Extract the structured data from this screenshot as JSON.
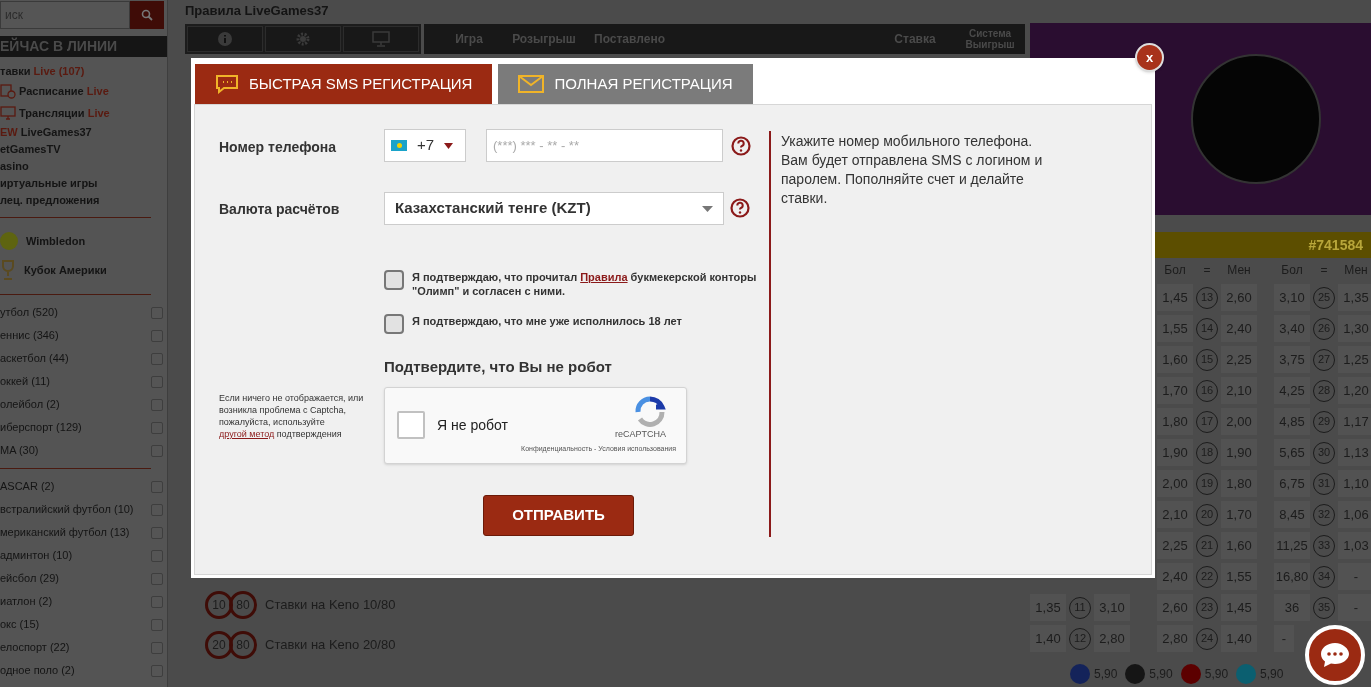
{
  "sidebar": {
    "search": {
      "placeholder": "иск"
    },
    "heading": "ЕЙЧАС В ЛИНИИ",
    "nav": [
      {
        "kind": "plain",
        "label": "тавки",
        "accent": "Live (107)"
      },
      {
        "kind": "schedule",
        "label": "Расписание",
        "accent": "Live"
      },
      {
        "kind": "broadcast",
        "label": "Трансляции",
        "accent": "Live"
      },
      {
        "kind": "plain",
        "badge": "EW",
        "label": "LiveGames37"
      },
      {
        "kind": "plain",
        "label": "etGamesTV"
      },
      {
        "kind": "plain",
        "label": "asino"
      },
      {
        "kind": "plain",
        "label": "иртуальные игры"
      },
      {
        "kind": "plain",
        "label": "лец. предложения"
      }
    ],
    "featured": [
      {
        "kind": "ball",
        "label": "Wimbledon"
      },
      {
        "kind": "cup",
        "label": "Кубок Америки"
      }
    ],
    "sport_groups": [
      [
        {
          "label": "утбол (520)",
          "checked": false
        },
        {
          "label": "еннис (346)",
          "checked": false
        },
        {
          "label": "аскетбол (44)",
          "checked": false
        },
        {
          "label": "оккей (11)",
          "checked": false
        },
        {
          "label": "олейбол (2)",
          "checked": false
        },
        {
          "label": "иберспорт (129)",
          "checked": false
        },
        {
          "label": "MA (30)",
          "checked": false
        }
      ],
      [
        {
          "label": "ASCAR (2)",
          "checked": false
        },
        {
          "label": "встралийский футбол (10)",
          "checked": false
        },
        {
          "label": "мериканский футбол (13)",
          "checked": false
        },
        {
          "label": "админтон (10)",
          "checked": false
        },
        {
          "label": "ейсбол (29)",
          "checked": false
        },
        {
          "label": "иатлон (2)",
          "checked": false
        },
        {
          "label": "окс (15)",
          "checked": false
        },
        {
          "label": "елоспорт (22)",
          "checked": false
        },
        {
          "label": "одное поло (2)",
          "checked": false
        }
      ]
    ]
  },
  "main": {
    "title": "Правила LiveGames37",
    "toolbar": [
      {
        "kind": "info"
      },
      {
        "kind": "gear"
      },
      {
        "kind": "monitor"
      }
    ],
    "columns": [
      "Игра",
      "Розыгрыш",
      "Поставлено",
      "Ставка",
      "Система Выигрыш"
    ],
    "keno": [
      {
        "balls": [
          "10",
          "80"
        ],
        "label": "Ставки на Keno 10/80"
      },
      {
        "balls": [
          "20",
          "80"
        ],
        "label": "Ставки на Keno 20/80"
      }
    ]
  },
  "draw": {
    "number": "#741584",
    "headers": [
      "Бол",
      "=",
      "Мен",
      "Бол",
      "=",
      "Мен"
    ],
    "rows": [
      {
        "g1": null,
        "g2": [
          "1,45",
          "13",
          "2,60"
        ],
        "g3": [
          "3,10",
          "25",
          "1,35"
        ]
      },
      {
        "g1": null,
        "g2": [
          "1,55",
          "14",
          "2,40"
        ],
        "g3": [
          "3,40",
          "26",
          "1,30"
        ]
      },
      {
        "g1": null,
        "g2": [
          "1,60",
          "15",
          "2,25"
        ],
        "g3": [
          "3,75",
          "27",
          "1,25"
        ]
      },
      {
        "g1": null,
        "g2": [
          "1,70",
          "16",
          "2,10"
        ],
        "g3": [
          "4,25",
          "28",
          "1,20"
        ]
      },
      {
        "g1": null,
        "g2": [
          "1,80",
          "17",
          "2,00"
        ],
        "g3": [
          "4,85",
          "29",
          "1,17"
        ]
      },
      {
        "g1": null,
        "g2": [
          "1,90",
          "18",
          "1,90"
        ],
        "g3": [
          "5,65",
          "30",
          "1,13"
        ]
      },
      {
        "g1": null,
        "g2": [
          "2,00",
          "19",
          "1,80"
        ],
        "g3": [
          "6,75",
          "31",
          "1,10"
        ]
      },
      {
        "g1": null,
        "g2": [
          "2,10",
          "20",
          "1,70"
        ],
        "g3": [
          "8,45",
          "32",
          "1,06"
        ]
      },
      {
        "g1": null,
        "g2": [
          "2,25",
          "21",
          "1,60"
        ],
        "g3": [
          "11,25",
          "33",
          "1,03"
        ]
      },
      {
        "g1": null,
        "g2": [
          "2,40",
          "22",
          "1,55"
        ],
        "g3": [
          "16,80",
          "34",
          "-"
        ]
      },
      {
        "g1": [
          "1,35",
          "11",
          "3,10"
        ],
        "g2": [
          "2,60",
          "23",
          "1,45"
        ],
        "g3": [
          "36",
          "35",
          "-"
        ]
      },
      {
        "g1": [
          "1,40",
          "12",
          "2,80"
        ],
        "g2": [
          "2,80",
          "24",
          "1,40"
        ],
        "g3": [
          "-"
        ]
      }
    ],
    "chips": [
      {
        "color": "#14235a",
        "value": "5,90"
      },
      {
        "color": "#151515",
        "value": "5,90"
      },
      {
        "color": "#5c0000",
        "value": "5,90"
      },
      {
        "color": "#0b5f70",
        "value": "5,90"
      }
    ]
  },
  "modal": {
    "close": "x",
    "tabs": [
      {
        "kind": "sms",
        "label": "БЫСТРАЯ SMS РЕГИСТРАЦИЯ",
        "selected": true
      },
      {
        "kind": "mail",
        "label": "ПОЛНАЯ РЕГИСТРАЦИЯ",
        "selected": false
      }
    ],
    "phone": {
      "label": "Номер телефона",
      "code": "+7",
      "placeholder": "(***) *** - ** - **"
    },
    "currency": {
      "label": "Валюта расчётов",
      "value": "Казахстанский тенге (KZT)"
    },
    "consents": [
      {
        "before": "Я подтверждаю, что прочитал ",
        "link": "Правила",
        "after": " букмекерской конторы \"Олимп\" и согласен с ними.",
        "checked": false
      },
      {
        "before": "Я подтверждаю, что мне уже исполнилось 18 лет",
        "checked": false
      }
    ],
    "captcha_title": "Подтвердите, что Вы не робот",
    "captcha_help": {
      "before": "Если ничего не отображается, или возникла проблема с Captcha, пожалуйста, используйте ",
      "link": "другой метод",
      "after": " подтверждения"
    },
    "captcha": {
      "label": "Я не робот",
      "brand": "reCAPTCHA",
      "footer": "Конфиденциальность - Условия использования",
      "checked": false
    },
    "submit": "ОТПРАВИТЬ",
    "info": "Укажите номер мобильного телефона. Вам будет отправлена SMS с логином и паролем. Пополняйте счет и делайте ставки."
  }
}
